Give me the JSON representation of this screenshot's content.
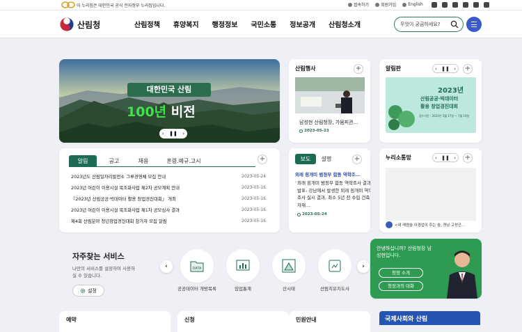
{
  "topbar": {
    "gov_notice": "이 누리집은 대한민국 공식 전자정부 누리집입니다.",
    "utils": [
      "접속하기",
      "회원가입",
      "English"
    ],
    "social_icons": [
      "twitter-icon",
      "facebook-icon",
      "youtube-icon",
      "blog-icon",
      "instagram-icon",
      "youtube-icon"
    ]
  },
  "header": {
    "logo_text": "산림청",
    "nav": [
      "산림정책",
      "휴양복지",
      "행정정보",
      "국민소통",
      "정보공개",
      "산림청소개"
    ],
    "search_placeholder": "무엇이 궁금하세요?"
  },
  "hero": {
    "title": "대한민국 산림",
    "sub_green": "100년",
    "sub_white": " 비전",
    "controls": [
      "‹",
      "❚❚",
      "›"
    ]
  },
  "events": {
    "title": "산림행사",
    "caption": "남성현 산림청장, 가뭄피관…",
    "date": "2023-05-23"
  },
  "board": {
    "title": "알림판",
    "banner_line1": "2023년",
    "banner_line2": "산림공공·빅데이터",
    "banner_line3": "활용 창업경진대회",
    "banner_note": "접수기간 : 2023년 5월 17일 ~ 7월 19일"
  },
  "notice": {
    "tabs": [
      "알림",
      "공고",
      "채용",
      "훈령.예규.고시"
    ],
    "items": [
      {
        "title": "2023년도 산림일자리발전소 그루경영체 모집 안내",
        "date": "2023-05-24"
      },
      {
        "title": "2023년 어린이 이용시설 목조화사업 제2차 공모계획 안내",
        "date": "2023-05-16"
      },
      {
        "title": "『2023년 산림공공·빅데이터 활용 창업경진대회』 개최",
        "date": "2023-05-16"
      },
      {
        "title": "2023년 어린이 이용시설 목조화사업 제1차 공모심사 결과",
        "date": "2023-05-16"
      },
      {
        "title": "제4회 산림분야 청년창업경진대회 참가자 모집 알림",
        "date": "2023-05-16"
      }
    ]
  },
  "press": {
    "tabs": [
      "보도",
      "설명"
    ],
    "headline": "외래 흰개미 범정부 합동 역학조…",
    "body": "외래 흰개미 범정부 합동 역학조사 결과 발표- 강남에서 발생한 외래 흰개미 역학조사 실시 결과, 최소 5년 전 수입 건축 자재…",
    "date": "2023-05-24"
  },
  "sns": {
    "title": "누리소통망",
    "post": "<내 ​레썸숲 이겸업이 주는 숲, 경남 고성군…"
  },
  "favorites": {
    "title": "자주찾는 서비스",
    "desc": "나만의 서비스를 설정하여 사용하실 수 있습니다.",
    "setting": "설정",
    "services": [
      "공공데이터 개방목록",
      "임업통계",
      "산시태",
      "산림치유지도사"
    ]
  },
  "promo": {
    "greeting": "안녕하십니까? 산림청장 남성현입니다.",
    "btn1": "청장 소개",
    "btn2": "청장과의 대화"
  },
  "bottom": {
    "cards": [
      "예약",
      "신청",
      "민원안내"
    ],
    "intl": "국제사회와 산림"
  },
  "colors": {
    "brand_green": "#1e6b55",
    "hero_green": "#42e14e",
    "promo_green": "#2e9a52",
    "accent_blue": "#3a5bc7",
    "intl_blue": "#2454b4"
  }
}
